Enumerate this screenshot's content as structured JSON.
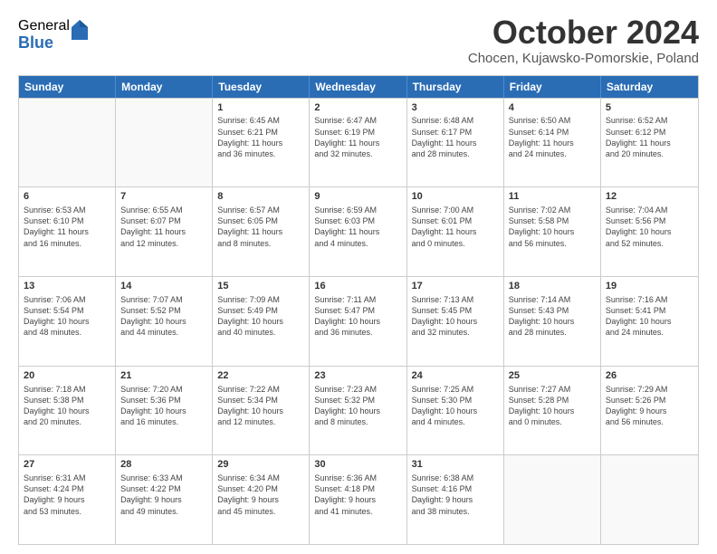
{
  "logo": {
    "general": "General",
    "blue": "Blue"
  },
  "title": "October 2024",
  "subtitle": "Chocen, Kujawsko-Pomorskie, Poland",
  "header_days": [
    "Sunday",
    "Monday",
    "Tuesday",
    "Wednesday",
    "Thursday",
    "Friday",
    "Saturday"
  ],
  "weeks": [
    [
      {
        "day": "",
        "info": ""
      },
      {
        "day": "",
        "info": ""
      },
      {
        "day": "1",
        "info": "Sunrise: 6:45 AM\nSunset: 6:21 PM\nDaylight: 11 hours\nand 36 minutes."
      },
      {
        "day": "2",
        "info": "Sunrise: 6:47 AM\nSunset: 6:19 PM\nDaylight: 11 hours\nand 32 minutes."
      },
      {
        "day": "3",
        "info": "Sunrise: 6:48 AM\nSunset: 6:17 PM\nDaylight: 11 hours\nand 28 minutes."
      },
      {
        "day": "4",
        "info": "Sunrise: 6:50 AM\nSunset: 6:14 PM\nDaylight: 11 hours\nand 24 minutes."
      },
      {
        "day": "5",
        "info": "Sunrise: 6:52 AM\nSunset: 6:12 PM\nDaylight: 11 hours\nand 20 minutes."
      }
    ],
    [
      {
        "day": "6",
        "info": "Sunrise: 6:53 AM\nSunset: 6:10 PM\nDaylight: 11 hours\nand 16 minutes."
      },
      {
        "day": "7",
        "info": "Sunrise: 6:55 AM\nSunset: 6:07 PM\nDaylight: 11 hours\nand 12 minutes."
      },
      {
        "day": "8",
        "info": "Sunrise: 6:57 AM\nSunset: 6:05 PM\nDaylight: 11 hours\nand 8 minutes."
      },
      {
        "day": "9",
        "info": "Sunrise: 6:59 AM\nSunset: 6:03 PM\nDaylight: 11 hours\nand 4 minutes."
      },
      {
        "day": "10",
        "info": "Sunrise: 7:00 AM\nSunset: 6:01 PM\nDaylight: 11 hours\nand 0 minutes."
      },
      {
        "day": "11",
        "info": "Sunrise: 7:02 AM\nSunset: 5:58 PM\nDaylight: 10 hours\nand 56 minutes."
      },
      {
        "day": "12",
        "info": "Sunrise: 7:04 AM\nSunset: 5:56 PM\nDaylight: 10 hours\nand 52 minutes."
      }
    ],
    [
      {
        "day": "13",
        "info": "Sunrise: 7:06 AM\nSunset: 5:54 PM\nDaylight: 10 hours\nand 48 minutes."
      },
      {
        "day": "14",
        "info": "Sunrise: 7:07 AM\nSunset: 5:52 PM\nDaylight: 10 hours\nand 44 minutes."
      },
      {
        "day": "15",
        "info": "Sunrise: 7:09 AM\nSunset: 5:49 PM\nDaylight: 10 hours\nand 40 minutes."
      },
      {
        "day": "16",
        "info": "Sunrise: 7:11 AM\nSunset: 5:47 PM\nDaylight: 10 hours\nand 36 minutes."
      },
      {
        "day": "17",
        "info": "Sunrise: 7:13 AM\nSunset: 5:45 PM\nDaylight: 10 hours\nand 32 minutes."
      },
      {
        "day": "18",
        "info": "Sunrise: 7:14 AM\nSunset: 5:43 PM\nDaylight: 10 hours\nand 28 minutes."
      },
      {
        "day": "19",
        "info": "Sunrise: 7:16 AM\nSunset: 5:41 PM\nDaylight: 10 hours\nand 24 minutes."
      }
    ],
    [
      {
        "day": "20",
        "info": "Sunrise: 7:18 AM\nSunset: 5:38 PM\nDaylight: 10 hours\nand 20 minutes."
      },
      {
        "day": "21",
        "info": "Sunrise: 7:20 AM\nSunset: 5:36 PM\nDaylight: 10 hours\nand 16 minutes."
      },
      {
        "day": "22",
        "info": "Sunrise: 7:22 AM\nSunset: 5:34 PM\nDaylight: 10 hours\nand 12 minutes."
      },
      {
        "day": "23",
        "info": "Sunrise: 7:23 AM\nSunset: 5:32 PM\nDaylight: 10 hours\nand 8 minutes."
      },
      {
        "day": "24",
        "info": "Sunrise: 7:25 AM\nSunset: 5:30 PM\nDaylight: 10 hours\nand 4 minutes."
      },
      {
        "day": "25",
        "info": "Sunrise: 7:27 AM\nSunset: 5:28 PM\nDaylight: 10 hours\nand 0 minutes."
      },
      {
        "day": "26",
        "info": "Sunrise: 7:29 AM\nSunset: 5:26 PM\nDaylight: 9 hours\nand 56 minutes."
      }
    ],
    [
      {
        "day": "27",
        "info": "Sunrise: 6:31 AM\nSunset: 4:24 PM\nDaylight: 9 hours\nand 53 minutes."
      },
      {
        "day": "28",
        "info": "Sunrise: 6:33 AM\nSunset: 4:22 PM\nDaylight: 9 hours\nand 49 minutes."
      },
      {
        "day": "29",
        "info": "Sunrise: 6:34 AM\nSunset: 4:20 PM\nDaylight: 9 hours\nand 45 minutes."
      },
      {
        "day": "30",
        "info": "Sunrise: 6:36 AM\nSunset: 4:18 PM\nDaylight: 9 hours\nand 41 minutes."
      },
      {
        "day": "31",
        "info": "Sunrise: 6:38 AM\nSunset: 4:16 PM\nDaylight: 9 hours\nand 38 minutes."
      },
      {
        "day": "",
        "info": ""
      },
      {
        "day": "",
        "info": ""
      }
    ]
  ]
}
